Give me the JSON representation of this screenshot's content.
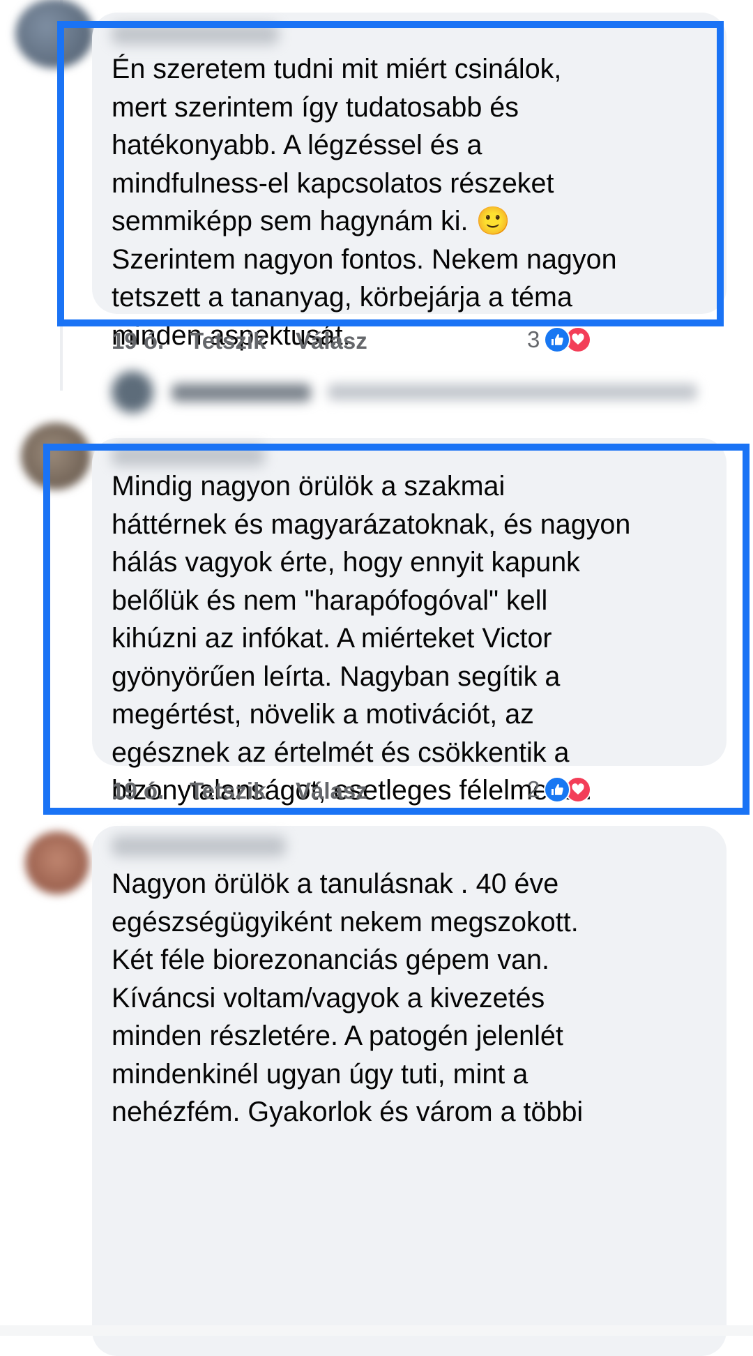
{
  "comments": [
    {
      "author": "",
      "text": "Én szeretem tudni mit miért csinálok,\nmert szerintem így tudatosabb és\nhatékonyabb. A légzéssel és a\nmindfulness-el kapcsolatos részeket\nsemmiképp sem hagynám ki. 🙂\nSzerintem nagyon fontos. Nekem nagyon\ntetszett a tananyag, körbejárja a téma\nminden aspektusát.",
      "time": "19 ó.",
      "like_label": "Tetszik",
      "reply_label": "Válasz",
      "reaction_count": "3"
    },
    {
      "author": "",
      "text": "Mindig nagyon örülök a szakmai\nháttérnek és magyarázatoknak, és nagyon\nhálás vagyok érte, hogy ennyit kapunk\nbelőlük és nem \"harapófogóval\" kell\nkihúzni az infókat. A miérteket Victor\ngyönyörűen leírta. Nagyban segítik a\nmegértést, növelik a motivációt, az\negésznek az értelmét és csökkentik a\nbizonytalanságot, esetleges félelmeket.",
      "time": "19 ó.",
      "like_label": "Tetszik",
      "reply_label": "Válasz",
      "reaction_count": "2"
    },
    {
      "author": "",
      "text": "Nagyon örülök a tanulásnak . 40 éve\negészségügyiként nekem  megszokott.\nKét féle biorezonanciás gépem van.\nKíváncsi voltam/vagyok a kivezetés\nminden részletére. A patogén jelenlét\nmindenkinél ugyan úgy tuti, mint a\nnehézfém. Gyakorlok és várom a többi"
    }
  ],
  "colors": {
    "highlight": "#1a73f5",
    "bubble": "#f0f2f5",
    "like": "#1877f2",
    "love": "#f33e58",
    "meta": "#65676b"
  },
  "icons": [
    "like-icon",
    "love-icon"
  ]
}
